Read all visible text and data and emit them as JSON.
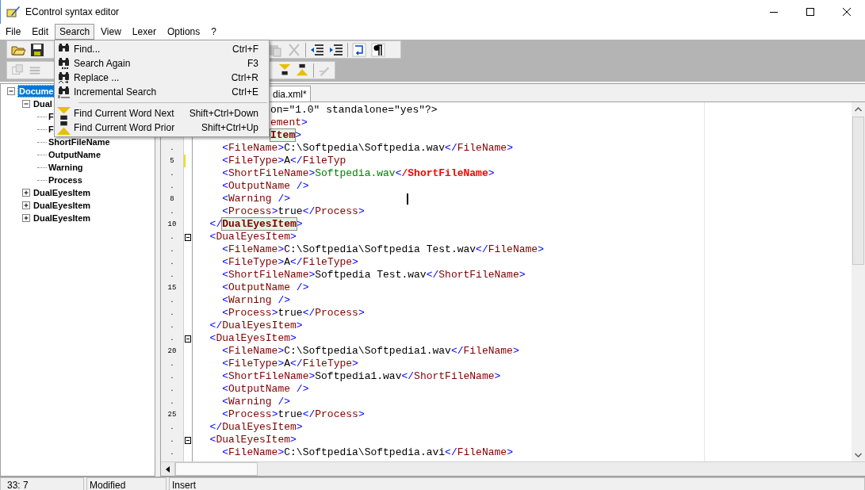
{
  "window": {
    "title": "EControl syntax editor"
  },
  "menu_bar": [
    {
      "label": "File",
      "selected": false
    },
    {
      "label": "Edit",
      "selected": false
    },
    {
      "label": "Search",
      "selected": true
    },
    {
      "label": "View",
      "selected": false
    },
    {
      "label": "Lexer",
      "selected": false
    },
    {
      "label": "Options",
      "selected": false
    },
    {
      "label": "?",
      "selected": false
    }
  ],
  "search_menu": {
    "groups": [
      [
        {
          "label": "Find...",
          "shortcut": "Ctrl+F"
        },
        {
          "label": "Search Again",
          "shortcut": "F3"
        },
        {
          "label": "Replace ...",
          "shortcut": "Ctrl+R"
        },
        {
          "label": "Incremental Search",
          "shortcut": "Ctrl+E"
        }
      ],
      [
        {
          "label": "Find Current Word Next",
          "shortcut": "Shift+Ctrl+Down"
        },
        {
          "label": "Find Current Word Prior",
          "shortcut": "Shift+Ctrl+Up"
        }
      ]
    ]
  },
  "tree": [
    {
      "label": "Docume",
      "selected": true,
      "expanded": true,
      "children": [
        {
          "label": "Dual",
          "selected": false,
          "expanded": true,
          "children": [
            {
              "label": "F",
              "selected": false
            },
            {
              "label": "F",
              "selected": false
            },
            {
              "label": "ShortFileName",
              "selected": false
            },
            {
              "label": "OutputName",
              "selected": false
            },
            {
              "label": "Warning",
              "selected": false
            },
            {
              "label": "Process",
              "selected": false
            }
          ]
        },
        {
          "label": "DualEyesItem",
          "selected": false,
          "expanded": false
        },
        {
          "label": "DualEyesItem",
          "selected": false,
          "expanded": false
        },
        {
          "label": "DualEyesItem",
          "selected": false,
          "expanded": false
        }
      ]
    }
  ],
  "editor": {
    "tab": {
      "label": "dia.xml*"
    },
    "lines": [
      {
        "kind": "partial",
        "tokens": [
          {
            "kind": "text",
            "text": "on=\"1.0\" standalone=\"yes\"?>"
          }
        ]
      },
      {
        "kind": "partial",
        "tokens": [
          {
            "kind": "tag",
            "text": "ement"
          },
          {
            "kind": "sym",
            "text": ">"
          }
        ]
      },
      {
        "kind": "partial",
        "tokens": [
          {
            "kind": "match",
            "text": "Item"
          },
          {
            "kind": "sym",
            "text": ">"
          }
        ]
      },
      {
        "kind": "full",
        "number": ".",
        "modified": false,
        "fold": false,
        "cursor": false,
        "tokens": [
          {
            "kind": "sym",
            "text": "    <"
          },
          {
            "kind": "tag",
            "text": "FileName"
          },
          {
            "kind": "sym",
            "text": ">"
          },
          {
            "kind": "text",
            "text": "C:\\Softpedia\\Softpedia.wav"
          },
          {
            "kind": "sym",
            "text": "</"
          },
          {
            "kind": "tag",
            "text": "FileName"
          },
          {
            "kind": "sym",
            "text": ">"
          }
        ]
      },
      {
        "kind": "full",
        "number": "5",
        "modified": true,
        "fold": false,
        "cursor": false,
        "tokens": [
          {
            "kind": "sym",
            "text": "    <"
          },
          {
            "kind": "tag",
            "text": "FileType"
          },
          {
            "kind": "sym",
            "text": ">"
          },
          {
            "kind": "text",
            "text": "A"
          },
          {
            "kind": "sym",
            "text": "</"
          },
          {
            "kind": "tag",
            "text": "FileTyp"
          }
        ]
      },
      {
        "kind": "full",
        "number": ".",
        "modified": false,
        "fold": false,
        "cursor": false,
        "tokens": [
          {
            "kind": "sym",
            "text": "    <"
          },
          {
            "kind": "tag",
            "text": "ShortFileName"
          },
          {
            "kind": "sym",
            "text": ">"
          },
          {
            "kind": "value",
            "text": "Softpedia.wav"
          },
          {
            "kind": "sym",
            "text": "<"
          },
          {
            "kind": "error",
            "text": "/ShortFileName"
          },
          {
            "kind": "sym",
            "text": ">"
          }
        ]
      },
      {
        "kind": "full",
        "number": ".",
        "modified": false,
        "fold": false,
        "cursor": false,
        "tokens": [
          {
            "kind": "sym",
            "text": "    <"
          },
          {
            "kind": "tag",
            "text": "OutputName"
          },
          {
            "kind": "sym",
            "text": " />"
          }
        ]
      },
      {
        "kind": "full",
        "number": "8",
        "modified": false,
        "fold": false,
        "cursor": true,
        "tokens": [
          {
            "kind": "sym",
            "text": "    <"
          },
          {
            "kind": "tag",
            "text": "Warning"
          },
          {
            "kind": "sym",
            "text": " />"
          }
        ]
      },
      {
        "kind": "full",
        "number": ".",
        "modified": false,
        "fold": false,
        "cursor": false,
        "tokens": [
          {
            "kind": "sym",
            "text": "    <"
          },
          {
            "kind": "tag",
            "text": "Process"
          },
          {
            "kind": "sym",
            "text": ">"
          },
          {
            "kind": "text",
            "text": "true"
          },
          {
            "kind": "sym",
            "text": "</"
          },
          {
            "kind": "tag",
            "text": "Process"
          },
          {
            "kind": "sym",
            "text": ">"
          }
        ]
      },
      {
        "kind": "full",
        "number": "10",
        "modified": false,
        "fold": false,
        "cursor": false,
        "tokens": [
          {
            "kind": "sym",
            "text": "  </"
          },
          {
            "kind": "match",
            "text": "DualEyesItem"
          },
          {
            "kind": "sym",
            "text": ">"
          }
        ]
      },
      {
        "kind": "full",
        "number": ".",
        "modified": false,
        "fold": true,
        "cursor": false,
        "tokens": [
          {
            "kind": "sym",
            "text": "  <"
          },
          {
            "kind": "tag",
            "text": "DualEyesItem"
          },
          {
            "kind": "sym",
            "text": ">"
          }
        ]
      },
      {
        "kind": "full",
        "number": ".",
        "modified": false,
        "fold": false,
        "cursor": false,
        "tokens": [
          {
            "kind": "sym",
            "text": "    <"
          },
          {
            "kind": "tag",
            "text": "FileName"
          },
          {
            "kind": "sym",
            "text": ">"
          },
          {
            "kind": "text",
            "text": "C:\\Softpedia\\Softpedia Test.wav"
          },
          {
            "kind": "sym",
            "text": "</"
          },
          {
            "kind": "tag",
            "text": "FileName"
          },
          {
            "kind": "sym",
            "text": ">"
          }
        ]
      },
      {
        "kind": "full",
        "number": ".",
        "modified": false,
        "fold": false,
        "cursor": false,
        "tokens": [
          {
            "kind": "sym",
            "text": "    <"
          },
          {
            "kind": "tag",
            "text": "FileType"
          },
          {
            "kind": "sym",
            "text": ">"
          },
          {
            "kind": "text",
            "text": "A"
          },
          {
            "kind": "sym",
            "text": "</"
          },
          {
            "kind": "tag",
            "text": "FileType"
          },
          {
            "kind": "sym",
            "text": ">"
          }
        ]
      },
      {
        "kind": "full",
        "number": ".",
        "modified": false,
        "fold": false,
        "cursor": false,
        "tokens": [
          {
            "kind": "sym",
            "text": "    <"
          },
          {
            "kind": "tag",
            "text": "ShortFileName"
          },
          {
            "kind": "sym",
            "text": ">"
          },
          {
            "kind": "text",
            "text": "Softpedia Test.wav"
          },
          {
            "kind": "sym",
            "text": "</"
          },
          {
            "kind": "tag",
            "text": "ShortFileName"
          },
          {
            "kind": "sym",
            "text": ">"
          }
        ]
      },
      {
        "kind": "full",
        "number": "15",
        "modified": false,
        "fold": false,
        "cursor": false,
        "tokens": [
          {
            "kind": "sym",
            "text": "    <"
          },
          {
            "kind": "tag",
            "text": "OutputName"
          },
          {
            "kind": "sym",
            "text": " />"
          }
        ]
      },
      {
        "kind": "full",
        "number": ".",
        "modified": false,
        "fold": false,
        "cursor": false,
        "tokens": [
          {
            "kind": "sym",
            "text": "    <"
          },
          {
            "kind": "tag",
            "text": "Warning"
          },
          {
            "kind": "sym",
            "text": " />"
          }
        ]
      },
      {
        "kind": "full",
        "number": ".",
        "modified": false,
        "fold": false,
        "cursor": false,
        "tokens": [
          {
            "kind": "sym",
            "text": "    <"
          },
          {
            "kind": "tag",
            "text": "Process"
          },
          {
            "kind": "sym",
            "text": ">"
          },
          {
            "kind": "text",
            "text": "true"
          },
          {
            "kind": "sym",
            "text": "</"
          },
          {
            "kind": "tag",
            "text": "Process"
          },
          {
            "kind": "sym",
            "text": ">"
          }
        ]
      },
      {
        "kind": "full",
        "number": ".",
        "modified": false,
        "fold": false,
        "cursor": false,
        "tokens": [
          {
            "kind": "sym",
            "text": "  </"
          },
          {
            "kind": "tag",
            "text": "DualEyesItem"
          },
          {
            "kind": "sym",
            "text": ">"
          }
        ]
      },
      {
        "kind": "full",
        "number": ".",
        "modified": false,
        "fold": true,
        "cursor": false,
        "tokens": [
          {
            "kind": "sym",
            "text": "  <"
          },
          {
            "kind": "tag",
            "text": "DualEyesItem"
          },
          {
            "kind": "sym",
            "text": ">"
          }
        ]
      },
      {
        "kind": "full",
        "number": "20",
        "modified": false,
        "fold": false,
        "cursor": false,
        "tokens": [
          {
            "kind": "sym",
            "text": "    <"
          },
          {
            "kind": "tag",
            "text": "FileName"
          },
          {
            "kind": "sym",
            "text": ">"
          },
          {
            "kind": "text",
            "text": "C:\\Softpedia\\Softpedia1.wav"
          },
          {
            "kind": "sym",
            "text": "</"
          },
          {
            "kind": "tag",
            "text": "FileName"
          },
          {
            "kind": "sym",
            "text": ">"
          }
        ]
      },
      {
        "kind": "full",
        "number": ".",
        "modified": false,
        "fold": false,
        "cursor": false,
        "tokens": [
          {
            "kind": "sym",
            "text": "    <"
          },
          {
            "kind": "tag",
            "text": "FileType"
          },
          {
            "kind": "sym",
            "text": ">"
          },
          {
            "kind": "text",
            "text": "A"
          },
          {
            "kind": "sym",
            "text": "</"
          },
          {
            "kind": "tag",
            "text": "FileType"
          },
          {
            "kind": "sym",
            "text": ">"
          }
        ]
      },
      {
        "kind": "full",
        "number": ".",
        "modified": false,
        "fold": false,
        "cursor": false,
        "tokens": [
          {
            "kind": "sym",
            "text": "    <"
          },
          {
            "kind": "tag",
            "text": "ShortFileName"
          },
          {
            "kind": "sym",
            "text": ">"
          },
          {
            "kind": "text",
            "text": "Softpedia1.wav"
          },
          {
            "kind": "sym",
            "text": "</"
          },
          {
            "kind": "tag",
            "text": "ShortFileName"
          },
          {
            "kind": "sym",
            "text": ">"
          }
        ]
      },
      {
        "kind": "full",
        "number": ".",
        "modified": false,
        "fold": false,
        "cursor": false,
        "tokens": [
          {
            "kind": "sym",
            "text": "    <"
          },
          {
            "kind": "tag",
            "text": "OutputName"
          },
          {
            "kind": "sym",
            "text": " />"
          }
        ]
      },
      {
        "kind": "full",
        "number": ".",
        "modified": false,
        "fold": false,
        "cursor": false,
        "tokens": [
          {
            "kind": "sym",
            "text": "    <"
          },
          {
            "kind": "tag",
            "text": "Warning"
          },
          {
            "kind": "sym",
            "text": " />"
          }
        ]
      },
      {
        "kind": "full",
        "number": "25",
        "modified": false,
        "fold": false,
        "cursor": false,
        "tokens": [
          {
            "kind": "sym",
            "text": "    <"
          },
          {
            "kind": "tag",
            "text": "Process"
          },
          {
            "kind": "sym",
            "text": ">"
          },
          {
            "kind": "text",
            "text": "true"
          },
          {
            "kind": "sym",
            "text": "</"
          },
          {
            "kind": "tag",
            "text": "Process"
          },
          {
            "kind": "sym",
            "text": ">"
          }
        ]
      },
      {
        "kind": "full",
        "number": ".",
        "modified": false,
        "fold": false,
        "cursor": false,
        "tokens": [
          {
            "kind": "sym",
            "text": "  </"
          },
          {
            "kind": "tag",
            "text": "DualEyesItem"
          },
          {
            "kind": "sym",
            "text": ">"
          }
        ]
      },
      {
        "kind": "full",
        "number": ".",
        "modified": false,
        "fold": true,
        "cursor": false,
        "tokens": [
          {
            "kind": "sym",
            "text": "  <"
          },
          {
            "kind": "tag",
            "text": "DualEyesItem"
          },
          {
            "kind": "sym",
            "text": ">"
          }
        ]
      },
      {
        "kind": "full",
        "number": ".",
        "modified": false,
        "fold": false,
        "cursor": false,
        "tokens": [
          {
            "kind": "sym",
            "text": "    <"
          },
          {
            "kind": "tag",
            "text": "FileName"
          },
          {
            "kind": "sym",
            "text": ">"
          },
          {
            "kind": "text",
            "text": "C:\\Softpedia\\Softpedia.avi"
          },
          {
            "kind": "sym",
            "text": "</"
          },
          {
            "kind": "tag",
            "text": "FileName"
          },
          {
            "kind": "sym",
            "text": ">"
          }
        ]
      }
    ]
  },
  "status_bar": [
    "33: 7",
    "Modified",
    "Insert"
  ]
}
